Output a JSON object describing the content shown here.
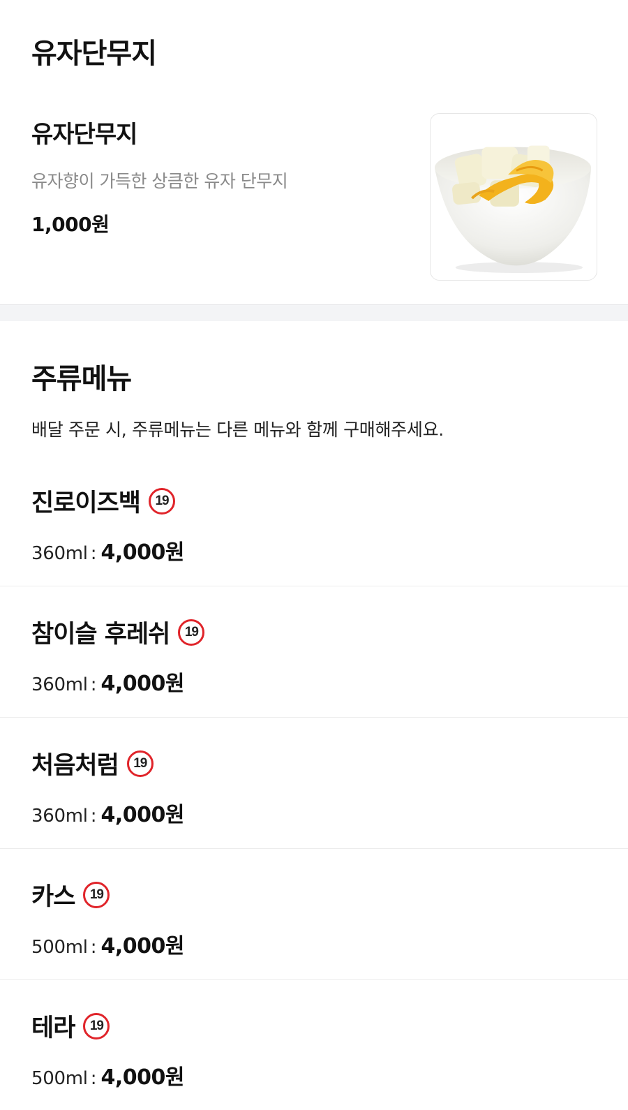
{
  "top_section": {
    "title": "유자단무지",
    "item": {
      "name": "유자단무지",
      "description": "유자향이 가득한 상큼한 유자 단무지",
      "price": "1,000원",
      "image_icon": "yuzu-pickled-radish-photo"
    }
  },
  "drinks_section": {
    "title": "주류메뉴",
    "notice": "배달 주문 시, 주류메뉴는 다른 메뉴와 함께 구매해주세요.",
    "age_badge_text": "19",
    "age_badge_color": "#e0242a",
    "items": [
      {
        "name": "진로이즈백",
        "volume": "360ml",
        "separator": ":",
        "price": "4,000원"
      },
      {
        "name": "참이슬 후레쉬",
        "volume": "360ml",
        "separator": ":",
        "price": "4,000원"
      },
      {
        "name": "처음처럼",
        "volume": "360ml",
        "separator": ":",
        "price": "4,000원"
      },
      {
        "name": "카스",
        "volume": "500ml",
        "separator": ":",
        "price": "4,000원"
      },
      {
        "name": "테라",
        "volume": "500ml",
        "separator": ":",
        "price": "4,000원"
      }
    ]
  }
}
